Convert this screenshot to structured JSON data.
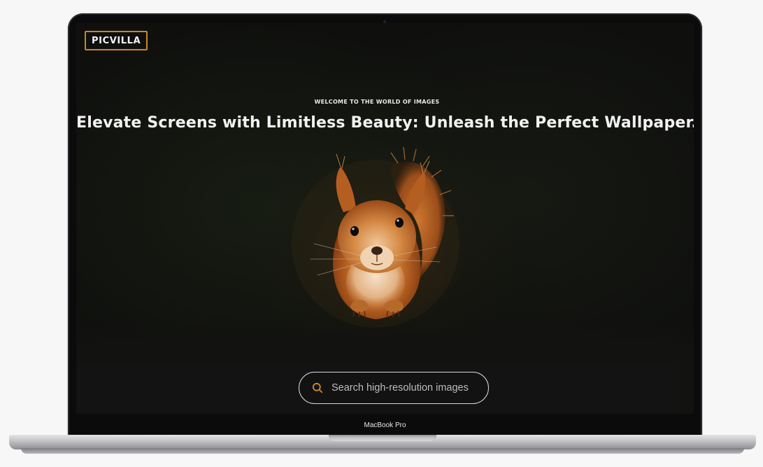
{
  "device": {
    "label": "MacBook Pro"
  },
  "site": {
    "logo_text": "PICVILLA",
    "accent_color": "#c9862c"
  },
  "hero": {
    "kicker": "WELCOME TO THE WORLD OF IMAGES",
    "headline": "Elevate Screens with Limitless Beauty: Unleash the Perfect Wallpaper.",
    "image_subject": "red squirrel on dark background"
  },
  "search": {
    "placeholder": "Search high-resolution images",
    "value": "",
    "icon": "search-icon"
  }
}
